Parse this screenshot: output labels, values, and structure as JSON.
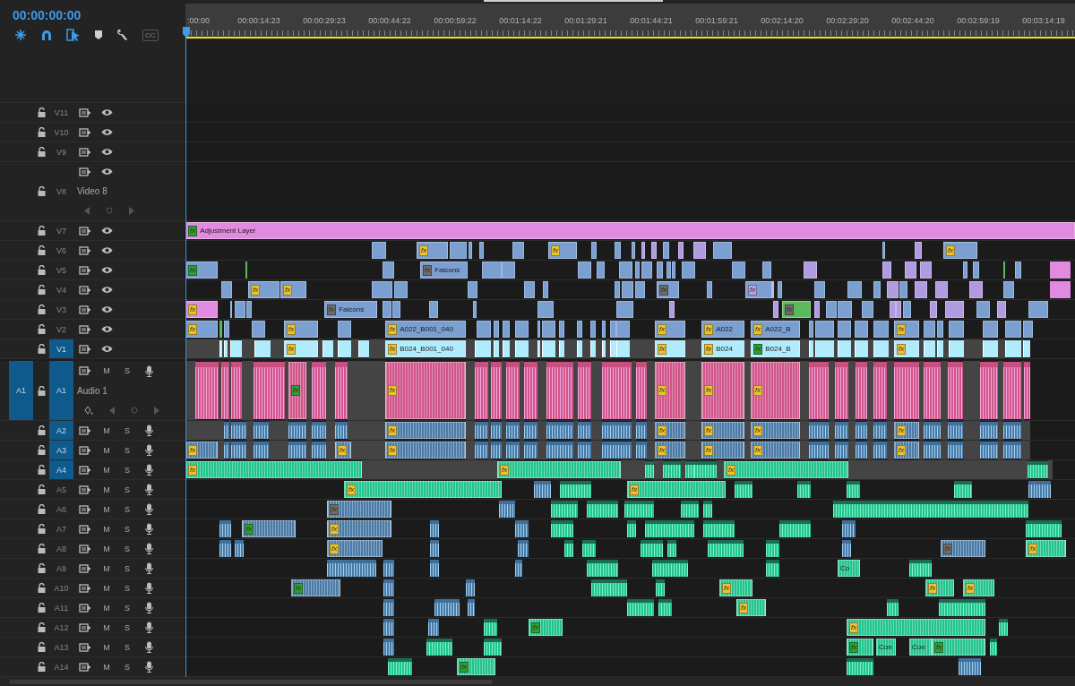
{
  "timecode": "00:00:00:00",
  "cc": "CC",
  "ruler": [
    ":00:00",
    "00:00:14:23",
    "00:00:29:23",
    "00:00:44:22",
    "00:00:59:22",
    "00:01:14:22",
    "00:01:29:21",
    "00:01:44:21",
    "00:01:59:21",
    "00:02:14:20",
    "00:02:29:20",
    "00:02:44:20",
    "00:02:59:19",
    "00:03:14:19"
  ],
  "video_tracks": [
    {
      "id": "V11",
      "targeted": false,
      "expanded": false
    },
    {
      "id": "V10",
      "targeted": false,
      "expanded": false
    },
    {
      "id": "V9",
      "targeted": false,
      "expanded": false
    },
    {
      "id": "V8",
      "targeted": false,
      "expanded": true,
      "name": "Video 8"
    },
    {
      "id": "V7",
      "targeted": false,
      "expanded": false,
      "clips": [
        {
          "badge": {
            "text": "fx",
            "color": "#2f9d3a"
          },
          "label": "Adjustment Layer",
          "color": "#e08ae0"
        }
      ]
    },
    {
      "id": "V6",
      "targeted": false,
      "expanded": false,
      "clips": [
        {
          "badge": {
            "text": "fx",
            "color": "#e9c23a"
          },
          "color": "#7a9fd0"
        },
        {
          "badge": {
            "text": "fx",
            "color": "#e9c23a"
          },
          "color": "#7a9fd0"
        },
        {
          "badge": {
            "text": "fx",
            "color": "#e9c23a"
          },
          "color": "#7a9fd0"
        }
      ]
    },
    {
      "id": "V5",
      "targeted": false,
      "expanded": false,
      "clips": [
        {
          "badge": {
            "text": "fx",
            "color": "#2f9d3a"
          },
          "color": "#7a9fd0"
        },
        {
          "badge": {
            "text": "fx",
            "color": "#6c6c6c"
          },
          "label": "Falcons",
          "color": "#7a9fd0"
        }
      ]
    },
    {
      "id": "V4",
      "targeted": false,
      "expanded": false,
      "clips": [
        {
          "badge": {
            "text": "fx",
            "color": "#e9c23a"
          },
          "color": "#7a9fd0"
        },
        {
          "badge": {
            "text": "fx",
            "color": "#e9c23a"
          },
          "color": "#7a9fd0"
        },
        {
          "badge": {
            "text": "fx",
            "color": "#6c6c6c"
          },
          "color": "#7a9fd0"
        },
        {
          "badge": {
            "text": "fx",
            "color": "#b7a0e8"
          },
          "color": "#7a9fd0"
        }
      ]
    },
    {
      "id": "V3",
      "targeted": false,
      "expanded": false,
      "clips": [
        {
          "badge": {
            "text": "fx",
            "color": "#e9c23a"
          },
          "color": "#e08ae0"
        },
        {
          "badge": {
            "text": "fx",
            "color": "#6c6c6c"
          },
          "label": "Falcons",
          "color": "#7a9fd0"
        },
        {
          "badge": {
            "text": "fx",
            "color": "#6c6c6c"
          },
          "color": "#5cb85c"
        }
      ]
    },
    {
      "id": "V2",
      "targeted": false,
      "expanded": false,
      "clips": [
        {
          "badge": {
            "text": "fx",
            "color": "#e9c23a"
          },
          "color": "#7a9fd0"
        },
        {
          "badge": {
            "text": "fx",
            "color": "#e9c23a"
          },
          "color": "#7a9fd0"
        },
        {
          "badge": {
            "text": "fx",
            "color": "#e9c23a"
          },
          "label": "A022_B001_040",
          "color": "#7a9fd0"
        },
        {
          "badge": {
            "text": "fx",
            "color": "#e9c23a"
          },
          "color": "#7a9fd0"
        },
        {
          "badge": {
            "text": "fx",
            "color": "#e9c23a"
          },
          "label": "A022",
          "color": "#7a9fd0"
        },
        {
          "badge": {
            "text": "fx",
            "color": "#e9c23a"
          },
          "label": "A022_B",
          "color": "#7a9fd0"
        },
        {
          "badge": {
            "text": "fx",
            "color": "#e9c23a"
          },
          "color": "#7a9fd0"
        }
      ]
    },
    {
      "id": "V1",
      "targeted": true,
      "expanded": false,
      "clips": [
        {
          "badge": {
            "text": "fx",
            "color": "#e9c23a"
          },
          "color": "#b0ecfd"
        },
        {
          "badge": {
            "text": "fx",
            "color": "#e9c23a"
          },
          "label": "B024_B001_040",
          "color": "#b0ecfd"
        },
        {
          "badge": {
            "text": "fx",
            "color": "#e9c23a"
          },
          "color": "#b0ecfd"
        },
        {
          "badge": {
            "text": "fx",
            "color": "#e9c23a"
          },
          "label": "B024",
          "color": "#b0ecfd"
        },
        {
          "badge": {
            "text": "fx",
            "color": "#2f9d3a"
          },
          "label": "B024_B",
          "color": "#b0ecfd"
        },
        {
          "badge": {
            "text": "fx",
            "color": "#e9c23a"
          },
          "color": "#b0ecfd"
        }
      ]
    }
  ],
  "audio_tracks": [
    {
      "id": "A1",
      "source_patch": "A1",
      "targeted": true,
      "expanded": true,
      "name": "Audio 1",
      "mute": "M",
      "solo": "S",
      "clips": [
        {
          "badge": {
            "text": "fx",
            "color": "#2f9d3a"
          },
          "color": "#d0558a"
        },
        {
          "badge": {
            "text": "fx",
            "color": "#e9c23a"
          },
          "color": "#d0558a"
        },
        {
          "badge": {
            "text": "fx",
            "color": "#e9c23a"
          },
          "color": "#d0558a"
        },
        {
          "badge": {
            "text": "fx",
            "color": "#e9c23a"
          },
          "color": "#d0558a"
        },
        {
          "badge": {
            "text": "fx",
            "color": "#e9c23a"
          },
          "color": "#d0558a"
        }
      ]
    },
    {
      "id": "A2",
      "targeted": true,
      "expanded": false,
      "mute": "M",
      "solo": "S",
      "clips": [
        {
          "badge": {
            "text": "fx",
            "color": "#e9c23a"
          },
          "color": "#4a7aa6"
        },
        {
          "badge": {
            "text": "fx",
            "color": "#e9c23a"
          },
          "color": "#4a7aa6"
        },
        {
          "badge": {
            "text": "fx",
            "color": "#e9c23a"
          },
          "color": "#4a7aa6"
        },
        {
          "badge": {
            "text": "fx",
            "color": "#e9c23a"
          },
          "color": "#4a7aa6"
        },
        {
          "badge": {
            "text": "fx",
            "color": "#e9c23a"
          },
          "color": "#4a7aa6"
        }
      ]
    },
    {
      "id": "A3",
      "targeted": true,
      "expanded": false,
      "mute": "M",
      "solo": "S",
      "clips": [
        {
          "badge": {
            "text": "fx",
            "color": "#e9c23a"
          },
          "color": "#4a7aa6"
        },
        {
          "badge": {
            "text": "fx",
            "color": "#e9c23a"
          },
          "color": "#4a7aa6"
        },
        {
          "badge": {
            "text": "fx",
            "color": "#e9c23a"
          },
          "color": "#4a7aa6"
        },
        {
          "badge": {
            "text": "fx",
            "color": "#e9c23a"
          },
          "color": "#4a7aa6"
        },
        {
          "badge": {
            "text": "fx",
            "color": "#e9c23a"
          },
          "color": "#4a7aa6"
        },
        {
          "badge": {
            "text": "fx",
            "color": "#e9c23a"
          },
          "color": "#4a7aa6"
        },
        {
          "badge": {
            "text": "fx",
            "color": "#e9c23a"
          },
          "color": "#4a7aa6"
        }
      ]
    },
    {
      "id": "A4",
      "targeted": true,
      "expanded": false,
      "mute": "M",
      "solo": "S",
      "clips": [
        {
          "badge": {
            "text": "fx",
            "color": "#e9c23a"
          },
          "color": "#22c48e"
        },
        {
          "badge": {
            "text": "fx",
            "color": "#e9c23a"
          },
          "color": "#22c48e"
        },
        {
          "badge": {
            "text": "fx",
            "color": "#e9c23a"
          },
          "color": "#22c48e"
        }
      ]
    },
    {
      "id": "A5",
      "targeted": false,
      "expanded": false,
      "mute": "M",
      "solo": "S",
      "clips": [
        {
          "badge": {
            "text": "fx",
            "color": "#e9c23a"
          },
          "color": "#22c48e"
        },
        {
          "badge": {
            "text": "fx",
            "color": "#e9c23a"
          },
          "color": "#22c48e"
        }
      ]
    },
    {
      "id": "A6",
      "targeted": false,
      "expanded": false,
      "mute": "M",
      "solo": "S",
      "clips": [
        {
          "badge": {
            "text": "fx",
            "color": "#6c6c6c"
          },
          "color": "#4a7aa6"
        }
      ]
    },
    {
      "id": "A7",
      "targeted": false,
      "expanded": false,
      "mute": "M",
      "solo": "S",
      "clips": [
        {
          "badge": {
            "text": "fx",
            "color": "#2f9d3a"
          },
          "color": "#4a7aa6"
        },
        {
          "badge": {
            "text": "fx",
            "color": "#e9c23a"
          },
          "color": "#4a7aa6"
        }
      ]
    },
    {
      "id": "A8",
      "targeted": false,
      "expanded": false,
      "mute": "M",
      "solo": "S",
      "clips": [
        {
          "badge": {
            "text": "fx",
            "color": "#e9c23a"
          },
          "color": "#4a7aa6"
        },
        {
          "badge": {
            "text": "fx",
            "color": "#6c6c6c"
          },
          "color": "#4a7aa6"
        },
        {
          "badge": {
            "text": "fx",
            "color": "#e9c23a"
          },
          "color": "#22c48e"
        }
      ]
    },
    {
      "id": "A9",
      "targeted": false,
      "expanded": false,
      "mute": "M",
      "solo": "S",
      "clips": [
        {
          "label": "Co",
          "color": "#22c48e"
        }
      ]
    },
    {
      "id": "A10",
      "targeted": false,
      "expanded": false,
      "mute": "M",
      "solo": "S",
      "clips": [
        {
          "badge": {
            "text": "fx",
            "color": "#2f9d3a"
          },
          "color": "#4a7aa6"
        },
        {
          "badge": {
            "text": "fx",
            "color": "#e9c23a"
          },
          "color": "#22c48e"
        },
        {
          "badge": {
            "text": "fx",
            "color": "#e9c23a"
          },
          "color": "#22c48e"
        },
        {
          "badge": {
            "text": "fx",
            "color": "#e9c23a"
          },
          "color": "#22c48e"
        }
      ]
    },
    {
      "id": "A11",
      "targeted": false,
      "expanded": false,
      "mute": "M",
      "solo": "S",
      "clips": [
        {
          "badge": {
            "text": "fx",
            "color": "#e9c23a"
          },
          "color": "#22c48e"
        }
      ]
    },
    {
      "id": "A12",
      "targeted": false,
      "expanded": false,
      "mute": "M",
      "solo": "S",
      "clips": [
        {
          "badge": {
            "text": "fx",
            "color": "#2f9d3a"
          },
          "color": "#22c48e"
        },
        {
          "badge": {
            "text": "fx",
            "color": "#e9c23a"
          },
          "color": "#22c48e"
        }
      ]
    },
    {
      "id": "A13",
      "targeted": false,
      "expanded": false,
      "mute": "M",
      "solo": "S",
      "clips": [
        {
          "badge": {
            "text": "fx",
            "color": "#2f9d3a"
          },
          "color": "#22c48e"
        },
        {
          "label": "Con",
          "color": "#22c48e"
        },
        {
          "label": "Con",
          "color": "#22c48e"
        },
        {
          "badge": {
            "text": "fx",
            "color": "#2f9d3a"
          },
          "color": "#22c48e"
        }
      ]
    },
    {
      "id": "A14",
      "targeted": false,
      "expanded": false,
      "mute": "M",
      "solo": "S",
      "clips": [
        {
          "badge": {
            "text": "fx",
            "color": "#2f9d3a"
          },
          "color": "#22c48e"
        }
      ]
    }
  ]
}
